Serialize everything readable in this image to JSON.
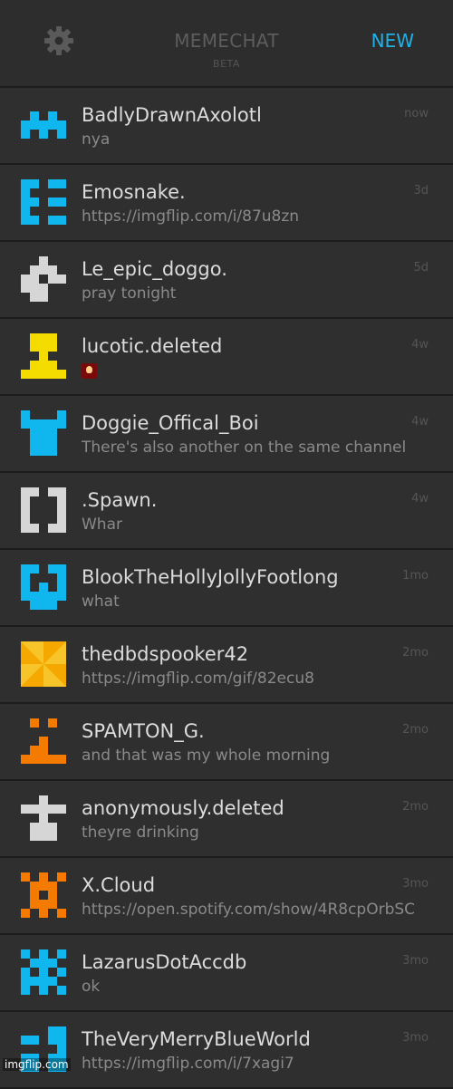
{
  "header": {
    "settings_icon": "gear-icon",
    "title": "MEMECHAT",
    "beta": "BETA",
    "new_label": "NEW"
  },
  "colors": {
    "accent": "#1fb2e6",
    "background": "#2f2f2f"
  },
  "conversations": [
    {
      "name": "BadlyDrawnAxolotl",
      "preview": "nya",
      "time": "now",
      "avatar": {
        "color": "#10b7ee",
        "bg": "",
        "cells": "0000001010111111010100000"
      }
    },
    {
      "name": "Emosnake.",
      "preview": "https://imgflip.com/i/87u8zn",
      "time": "3d",
      "avatar": {
        "color": "#10b7ee",
        "bg": "",
        "cells": "1101110000110111000011011"
      }
    },
    {
      "name": "Le_epic_doggo.",
      "preview": "pray tonight",
      "time": "5d",
      "avatar": {
        "color": "#d6d6d6",
        "bg": "",
        "cells": "0010001110110111110001100"
      }
    },
    {
      "name": "lucotic.deleted",
      "preview": "",
      "preview_icon": "explosion-emoji-icon",
      "time": "4w",
      "avatar": {
        "color": "#f5dc00",
        "bg": "",
        "cells": "0111001110001000111011111"
      }
    },
    {
      "name": "Doggie_Offical_Boi",
      "preview": "There's also another on the same channel",
      "time": "4w",
      "avatar": {
        "color": "#10b7ee",
        "bg": "",
        "cells": "1000111111011100111001110"
      }
    },
    {
      "name": ".Spawn.",
      "preview": "Whar",
      "time": "4w",
      "avatar": {
        "color": "#d6d6d6",
        "bg": "",
        "cells": "1101110001100011000111011"
      }
    },
    {
      "name": "BlookTheHollyJollyFootlong",
      "preview": "what",
      "time": "1mo",
      "avatar": {
        "color": "#10b7ee",
        "bg": "",
        "cells": "1101110001101011111101110"
      }
    },
    {
      "name": "thedbdspooker42",
      "preview": "https://imgflip.com/gif/82ecu8",
      "time": "2mo",
      "avatar": {
        "color": "#f5a800",
        "bg": "#f7c42a",
        "cells": ""
      }
    },
    {
      "name": "SPAMTON_G.",
      "preview": "and that was my whole morning",
      "time": "2mo",
      "avatar": {
        "color": "#f57a00",
        "bg": "",
        "cells": "0101000000001000110011111"
      }
    },
    {
      "name": "anonymously.deleted",
      "preview": "theyre drinking",
      "time": "2mo",
      "avatar": {
        "color": "#d6d6d6",
        "bg": "",
        "cells": "0010011111001000111001110"
      }
    },
    {
      "name": "X.Cloud",
      "preview": "https://open.spotify.com/show/4R8cpOrbSC",
      "time": "3mo",
      "avatar": {
        "color": "#f57a00",
        "bg": "",
        "cells": "1010101110010100111010101"
      }
    },
    {
      "name": "LazarusDotAccdb",
      "preview": "ok",
      "time": "3mo",
      "avatar": {
        "color": "#10b7ee",
        "bg": "",
        "cells": "1010101110101011111010101"
      }
    },
    {
      "name": "TheVeryMerryBlueWorld",
      "preview": "https://imgflip.com/i/7xagi7",
      "time": "3mo",
      "avatar": {
        "color": "#10b7ee",
        "bg": "",
        "cells": "0001111011000011101111011"
      }
    }
  ],
  "watermark": "imgflip.com"
}
